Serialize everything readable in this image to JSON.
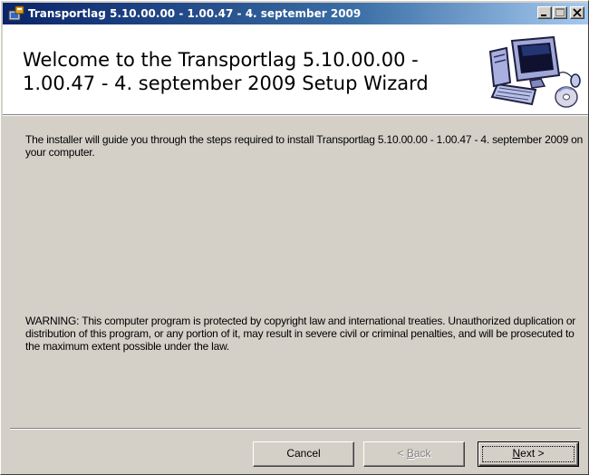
{
  "window": {
    "title": "Transportlag 5.10.00.00 - 1.00.47 - 4. september 2009"
  },
  "banner": {
    "title": "Welcome to the Transportlag 5.10.00.00 - 1.00.47 - 4. september 2009 Setup Wizard",
    "graphic": "computer-cd-icon"
  },
  "content": {
    "intro": "The installer will guide you through the steps required to install Transportlag 5.10.00.00 - 1.00.47 - 4. september 2009 on your computer.",
    "warning": "WARNING: This computer program is protected by copyright law and international treaties. Unauthorized duplication or distribution of this program, or any portion of it, may result in severe civil or criminal penalties, and will be prosecuted to the maximum extent possible under the law."
  },
  "buttons": {
    "cancel": "Cancel",
    "back_prefix": "< ",
    "back_mnemonic": "B",
    "back_rest": "ack",
    "next_mnemonic": "N",
    "next_rest": "ext >"
  },
  "colors": {
    "face": "#d4d0c8",
    "title_start": "#0a246a",
    "title_end": "#a6caf0",
    "banner_bg": "#ffffff"
  }
}
